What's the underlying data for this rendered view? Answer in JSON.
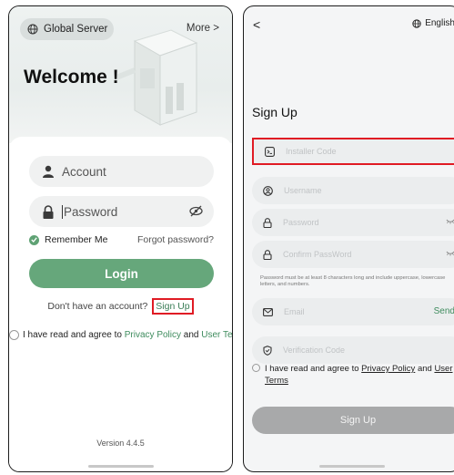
{
  "login": {
    "server_label": "Global Server",
    "more_label": "More >",
    "welcome": "Welcome !",
    "account_placeholder": "Account",
    "password_placeholder": "Password",
    "remember_me": "Remember Me",
    "forgot_password": "Forgot password?",
    "login_button": "Login",
    "no_account_text": "Don't have an account?",
    "signup_link": "Sign Up",
    "agree_prefix": "I have read and agree to",
    "privacy_policy": "Privacy Policy",
    "and": "and",
    "user_terms": "User Terms",
    "version": "Version 4.4.5"
  },
  "signup": {
    "back": "<",
    "language": "English",
    "title": "Sign Up",
    "installer_code": "Installer Code",
    "username": "Username",
    "password": "Password",
    "confirm_password": "Confirm PassWord",
    "password_hint": "Password must be at least 8 characters long and include uppercase, lowercase letters, and numbers.",
    "email": "Email",
    "send": "Send",
    "verification_code": "Verification Code",
    "agree_prefix": "I have read and agree to",
    "privacy_policy": "Privacy Policy",
    "and": "and",
    "user_terms": "User Terms",
    "signup_button": "Sign Up"
  },
  "colors": {
    "accent_green": "#66a77b",
    "highlight_red": "#e01b24",
    "disabled_gray": "#a8a9aa"
  }
}
